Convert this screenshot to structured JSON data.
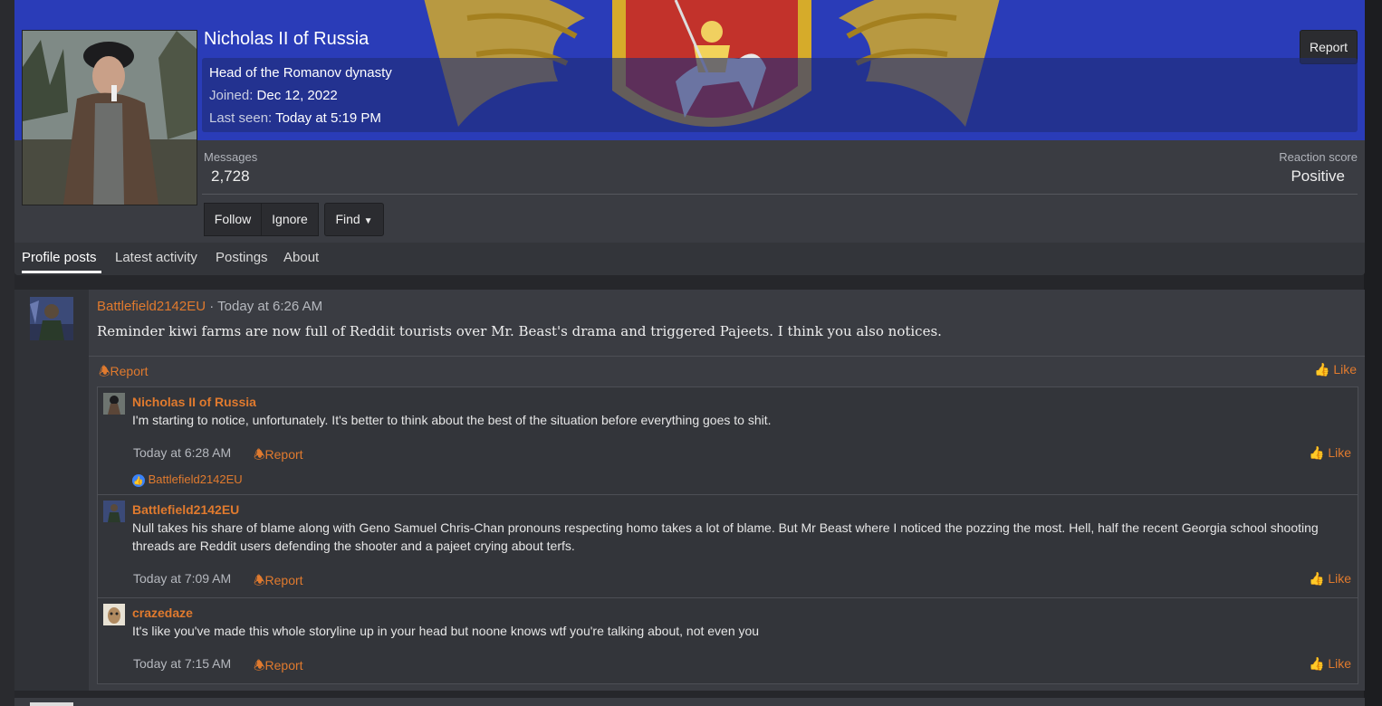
{
  "profile": {
    "name": "Nicholas II of Russia",
    "report_label": "Report",
    "title": "Head of the Romanov dynasty",
    "joined_label": "Joined:",
    "joined_value": "Dec 12, 2022",
    "last_seen_label": "Last seen:",
    "last_seen_value": "Today at 5:19 PM",
    "messages_label": "Messages",
    "messages_value": "2,728",
    "reaction_label": "Reaction score",
    "reaction_value": "Positive",
    "buttons": {
      "follow": "Follow",
      "ignore": "Ignore",
      "find": "Find"
    }
  },
  "tabs": [
    "Profile posts",
    "Latest activity",
    "Postings",
    "About"
  ],
  "post": {
    "author": "Battlefield2142EU",
    "separator": "·",
    "time": "Today at 6:26 AM",
    "body": "Reminder kiwi farms are now full of Reddit tourists over Mr. Beast's drama and triggered Pajeets. I think you also notices.",
    "report_label": "Report",
    "like_label": "Like"
  },
  "comments": [
    {
      "author": "Nicholas II of Russia",
      "text": "I'm starting to notice, unfortunately. It's better to think about the best of the situation before everything goes to shit.",
      "time": "Today at 6:28 AM",
      "report_label": "Report",
      "like_label": "Like",
      "reaction_user": "Battlefield2142EU"
    },
    {
      "author": "Battlefield2142EU",
      "text": "Null takes his share of blame along with Geno Samuel Chris-Chan pronouns respecting homo takes a lot of blame. But Mr Beast where I noticed the pozzing the most. Hell, half the recent Georgia school shooting threads are Reddit users defending the shooter and a pajeet crying about terfs.",
      "time": "Today at 7:09 AM",
      "report_label": "Report",
      "like_label": "Like"
    },
    {
      "author": "crazedaze",
      "text": "It's like you've made this whole storyline up in your head but noone knows wtf you're talking about, not even you",
      "time": "Today at 7:15 AM",
      "report_label": "Report",
      "like_label": "Like"
    }
  ],
  "colors": {
    "accent": "#e07a2e",
    "banner": "#2a3cb8",
    "panel": "#3a3c42",
    "background": "#26272b"
  }
}
